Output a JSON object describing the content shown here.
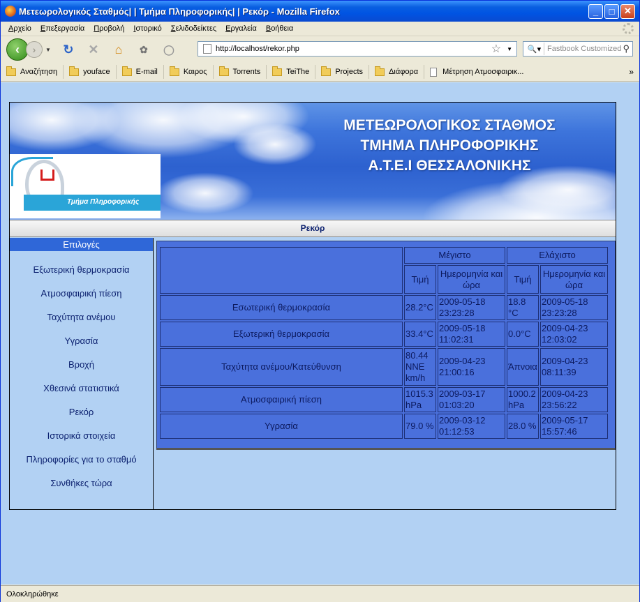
{
  "window": {
    "title": "Μετεωρολογικός Σταθμός| | Τμήμα Πληροφορικής| | Ρεκόρ - Mozilla Firefox"
  },
  "menu": [
    "Αρχείο",
    "Επεξεργασία",
    "Προβολή",
    "Ιστορικό",
    "Σελιδοδείκτες",
    "Εργαλεία",
    "Βοήθεια"
  ],
  "nav": {
    "url": "http://localhost/rekor.php",
    "search_placeholder": "Fastbook Customized"
  },
  "bookmarks": [
    "Αναζήτηση",
    "youface",
    "E-mail",
    "Καιρος",
    "Torrents",
    "TeiThe",
    "Projects",
    "Διάφορα",
    "Μέτρηση Ατμοσφαιρικ..."
  ],
  "banner": {
    "line1": "ΜΕΤΕΩΡΟΛΟΓΙΚΟΣ ΣΤΑΘΜΟΣ",
    "line2": "ΤΜΗΜΑ ΠΛΗΡΟΦΟΡΙΚΗΣ",
    "line3": "Α.Τ.Ε.Ι ΘΕΣΣΑΛΟΝΙΚΗΣ",
    "logo_text": "Τμήμα Πληροφορικής"
  },
  "page": {
    "heading": "Ρεκόρ"
  },
  "sidebar": {
    "header": "Επιλογές",
    "items": [
      "Εξωτερική θερμοκρασία",
      "Ατμοσφαιρική πίεση",
      "Ταχύτητα ανέμου",
      "Υγρασία",
      "Βροχή",
      "Χθεσινά στατιστικά",
      "Ρεκόρ",
      "Ιστορικά στοιχεία",
      "Πληροφορίες για το σταθμό",
      "Συνθήκες τώρα"
    ]
  },
  "records": {
    "max_label": "Μέγιστο",
    "min_label": "Ελάχιστο",
    "value_label": "Τιμή",
    "date_label": "Ημερομηνία και ώρα",
    "rows": [
      {
        "label": "Εσωτερική θερμοκρασία",
        "max_value": "28.2°C",
        "max_date": "2009-05-18 23:23:28",
        "min_value": "18.8 °C",
        "min_date": "2009-05-18 23:23:28"
      },
      {
        "label": "Εξωτερική θερμοκρασία",
        "max_value": "33.4°C",
        "max_date": "2009-05-18 11:02:31",
        "min_value": "0.0°C",
        "min_date": "2009-04-23 12:03:02"
      },
      {
        "label": "Ταχύτητα ανέμου/Κατεύθυνση",
        "max_value": "80.44 NNE km/h",
        "max_date": "2009-04-23 21:00:16",
        "min_value": "Άπνοια",
        "min_date": "2009-04-23 08:11:39"
      },
      {
        "label": "Ατμοσφαιρική πίεση",
        "max_value": "1015.3 hPa",
        "max_date": "2009-03-17 01:03:20",
        "min_value": "1000.2 hPa",
        "min_date": "2009-04-23 23:56:22"
      },
      {
        "label": "Υγρασία",
        "max_value": "79.0 %",
        "max_date": "2009-03-12 01:12:53",
        "min_value": "28.0 %",
        "min_date": "2009-05-17 15:57:46"
      }
    ]
  },
  "status": {
    "text": "Ολοκληρώθηκε"
  }
}
